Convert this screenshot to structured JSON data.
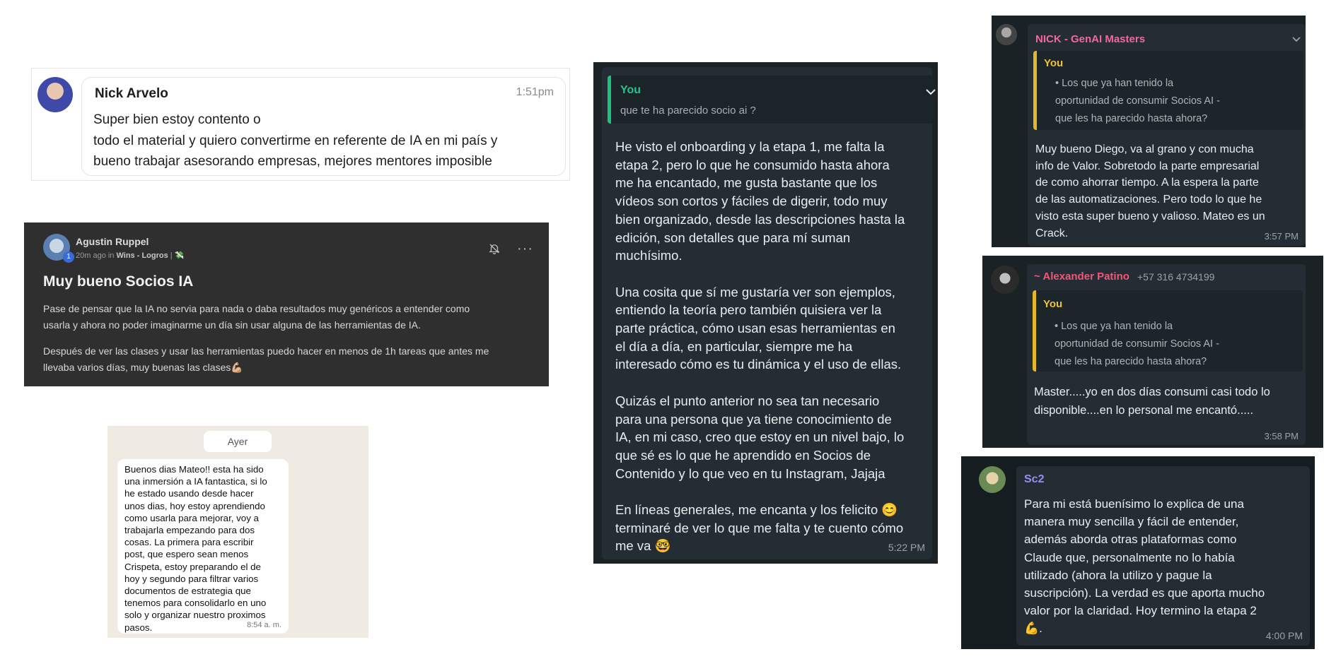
{
  "card1": {
    "name": "Nick Arvelo",
    "time": "1:51pm",
    "message": "Super bien estoy contento o\ntodo el material y quiero convertirme en referente de IA en mi país y\nbueno trabajar asesorando empresas, mejores mentores imposible"
  },
  "card2": {
    "name": "Agustin Ruppel",
    "badge": "1",
    "meta_time": "20m ago in",
    "meta_group": "Wins - Logros",
    "meta_sep": "|",
    "meta_emoji": "💸",
    "title": "Muy bueno Socios IA",
    "paragraph1": "Pase de pensar que la IA no servia para nada o daba resultados muy genéricos a entender como\nusarla y ahora no poder imaginarme un día sin usar alguna de las herramientas de IA.",
    "paragraph2": "Después de ver las clases y usar las herramientas puedo hacer en menos de 1h tareas que antes me\nllevaba varios días, muy buenas las clases💪🏼"
  },
  "card3": {
    "day": "Ayer",
    "message": "Buenos dias Mateo!! esta ha sido\nuna inmersión a IA fantastica, si lo\nhe estado usando desde hacer\nunos dias, hoy estoy aprendiendo\ncomo usarla para mejorar, voy a\ntrabajarla empezando para dos\ncosas. La  primera para escribir\npost, que espero sean menos\nCrispeta, estoy preparando el de\nhoy y segundo para filtrar varios\ndocumentos de estrategia que\ntenemos para consolidarlo en uno\nsolo y organizar nuestro proximos\npasos.",
    "time": "8:54 a. m."
  },
  "card4": {
    "quote_name": "You",
    "quote_text": "que te ha parecido socio ai ?",
    "message": "He visto el onboarding y la etapa 1, me falta la\netapa 2, pero lo que he consumido hasta ahora\nme ha encantado, me gusta bastante que los\nvídeos son cortos y fáciles de digerir, todo muy\nbien organizado, desde las descripciones hasta la\nedición, son detalles que para mí suman\nmuchísimo.\n\nUna cosita que sí me gustaría ver son ejemplos,\nentiendo la teoría pero también quisiera ver la\nparte práctica, cómo usan esas herramientas en\nel día a día, en particular, siempre me ha\ninteresado cómo es tu dinámica y el uso de ellas.\n\nQuizás el punto anterior no sea tan necesario\npara una persona que ya tiene conocimiento de\nIA, en mi caso, creo que estoy en un nivel bajo, lo\nque sé es lo que he aprendido en Socios de\nContenido y lo que veo en tu Instagram, Jajaja\n\nEn líneas generales, me encanta y los felicito 😊\nterminaré de ver lo que me falta y te cuento cómo\nme va 🤓",
    "time": "5:22 PM"
  },
  "card5": {
    "name": "NICK - GenAI Masters",
    "quote_name": "You",
    "quote_text": "• Los que ya han tenido la\n  oportunidad de consumir Socios AI -\n  que les ha parecido hasta ahora?",
    "message": "Muy bueno Diego, va al grano y con mucha\ninfo de Valor. Sobretodo la parte empresarial\nde como ahorrar tiempo. A la espera la parte\nde las automatizaciones. Pero todo lo que he\nvisto esta super bueno y valioso. Mateo es un\nCrack.",
    "time": "3:57 PM"
  },
  "card6": {
    "name": "~ Alexander Patino",
    "phone": "+57 316 4734199",
    "quote_name": "You",
    "quote_text": "• Los que ya han tenido la\n  oportunidad de consumir Socios AI -\n  que les ha parecido hasta ahora?",
    "message": "Master.....yo en dos días  consumi casi todo lo\ndisponible....en lo personal me encantó.....",
    "time": "3:58 PM"
  },
  "card7": {
    "name": "Sc2",
    "message": "Para mi está buenísimo lo explica de una\nmanera muy sencilla y fácil de entender,\nademás aborda otras plataformas como\nClaude que, personalmente no lo había\nutilizado (ahora la utilizo y pague la\nsuscripción). La verdad es que aporta mucho\nvalor por la claridad. Hoy termino la etapa 2\n💪.",
    "time": "4:00 PM"
  }
}
